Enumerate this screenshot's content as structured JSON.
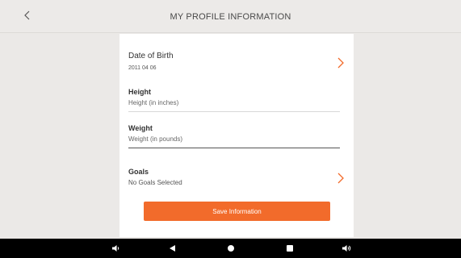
{
  "header": {
    "back_icon": "chevron-left-icon",
    "title": "MY PROFILE INFORMATION"
  },
  "form": {
    "date_of_birth": {
      "label": "Date of Birth",
      "value": "2011 04 06",
      "action_icon": "chevron-right-icon"
    },
    "height": {
      "label": "Height",
      "placeholder": "Height (in inches)"
    },
    "weight": {
      "label": "Weight",
      "placeholder": "Weight (in pounds)"
    },
    "goals": {
      "label": "Goals",
      "value": "No Goals Selected",
      "action_icon": "chevron-right-icon"
    },
    "save_label": "Save Information"
  },
  "system_nav": {
    "icons": [
      "volume-down-icon",
      "back-triangle-icon",
      "home-circle-icon",
      "recents-square-icon",
      "volume-up-icon"
    ]
  },
  "colors": {
    "accent": "#f26b2b",
    "background": "#ebe9e7",
    "card": "#ffffff",
    "navbar": "#000000"
  }
}
